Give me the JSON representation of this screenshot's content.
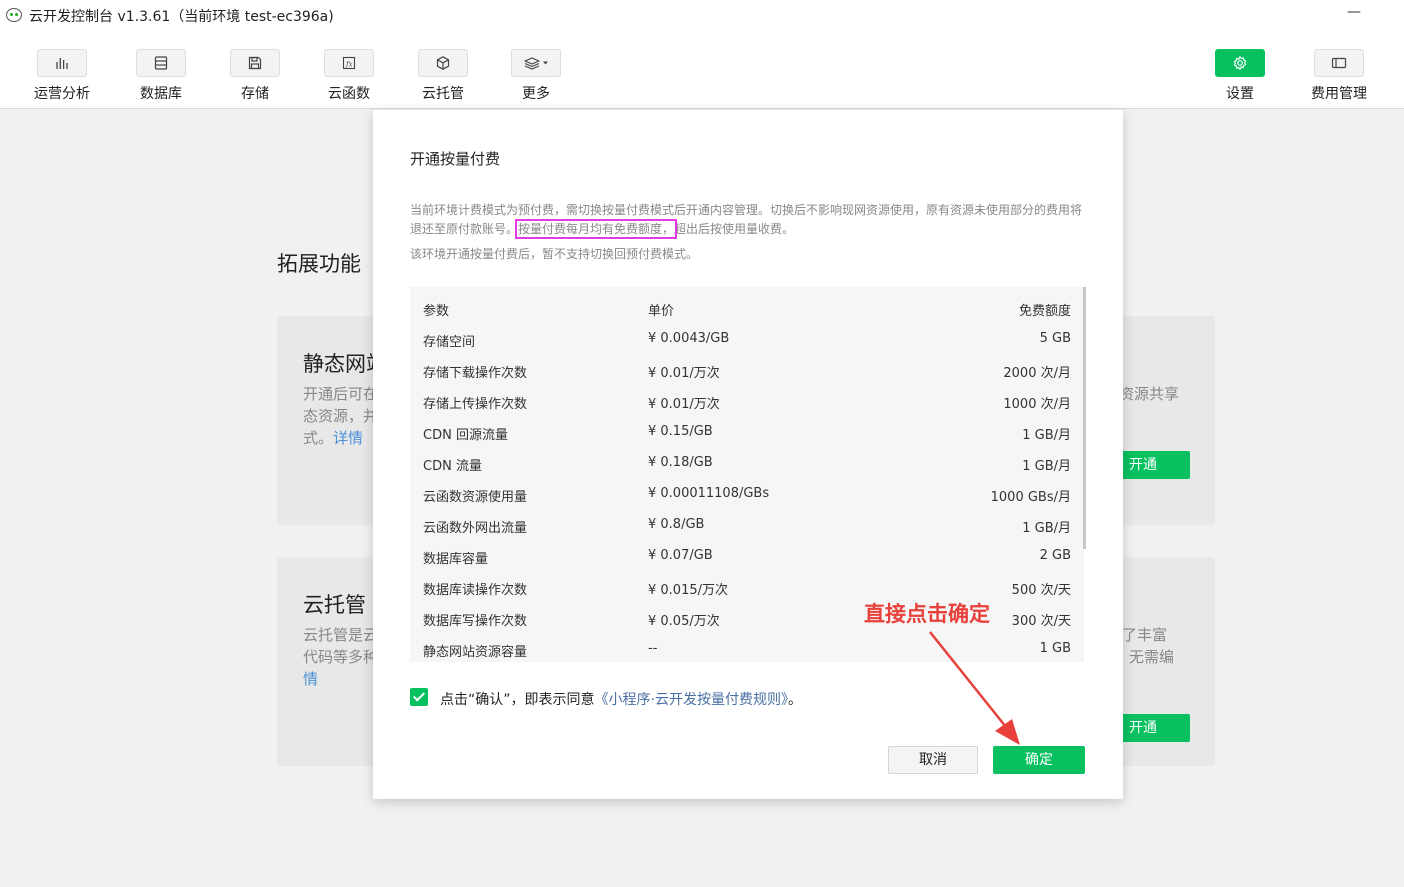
{
  "window": {
    "title": "云开发控制台 v1.3.61（当前环境 test-ec396a)",
    "minimize": "—"
  },
  "toolbar": {
    "left": [
      {
        "label": "运营分析",
        "icon": "bar-chart-icon"
      },
      {
        "label": "数据库",
        "icon": "database-icon"
      },
      {
        "label": "存储",
        "icon": "save-disk-icon"
      },
      {
        "label": "云函数",
        "icon": "function-icon"
      },
      {
        "label": "云托管",
        "icon": "cube-icon"
      },
      {
        "label": "更多",
        "icon": "layers-dropdown-icon"
      }
    ],
    "right": [
      {
        "label": "设置",
        "icon": "gear-icon"
      },
      {
        "label": "费用管理",
        "icon": "wallet-icon"
      }
    ]
  },
  "page": {
    "section_title": "拓展功能",
    "card1": {
      "title": "静态网站",
      "desc_line1": "开通后可在",
      "desc_line2": "态资源，并",
      "desc_line3": "式。",
      "detail": "详情",
      "right_desc": "资源共享",
      "open": "开通"
    },
    "card2": {
      "title": "云托管",
      "desc_line1": "云托管是云",
      "desc_line2": "代码等多种",
      "detail": "情",
      "right_desc1": "了丰富",
      "right_desc2": "无需编",
      "open": "开通"
    }
  },
  "modal": {
    "title": "开通按量付费",
    "notice_part1": "当前环境计费模式为预付费，需切换按量付费模式后开通内容管理。切换后不影响现网资源使用，原有资源未使用部分的费用将退还至原付款账号。",
    "notice_highlight": "按量付费每月均有免费额度，",
    "notice_part2": "超出后按使用量收费。",
    "notice2": "该环境开通按量付费后，暂不支持切换回预付费模式。",
    "table": {
      "headers": [
        "参数",
        "单价",
        "免费额度"
      ],
      "rows": [
        [
          "存储空间",
          "¥ 0.0043/GB",
          "5 GB"
        ],
        [
          "存储下载操作次数",
          "¥ 0.01/万次",
          "2000 次/月"
        ],
        [
          "存储上传操作次数",
          "¥ 0.01/万次",
          "1000 次/月"
        ],
        [
          "CDN 回源流量",
          "¥ 0.15/GB",
          "1 GB/月"
        ],
        [
          "CDN 流量",
          "¥ 0.18/GB",
          "1 GB/月"
        ],
        [
          "云函数资源使用量",
          "¥ 0.00011108/GBs",
          "1000 GBs/月"
        ],
        [
          "云函数外网出流量",
          "¥ 0.8/GB",
          "1 GB/月"
        ],
        [
          "数据库容量",
          "¥ 0.07/GB",
          "2 GB"
        ],
        [
          "数据库读操作次数",
          "¥ 0.015/万次",
          "500 次/天"
        ],
        [
          "数据库写操作次数",
          "¥ 0.05/万次",
          "300 次/天"
        ],
        [
          "静态网站资源容量",
          "--",
          "1 GB"
        ]
      ]
    },
    "agree_prefix": "点击“确认”，即表示同意",
    "agree_link": "《小程序·云开发按量付费规则》",
    "agree_suffix": "。",
    "agree_checked": true,
    "cancel": "取消",
    "confirm": "确定"
  },
  "annotation": {
    "text": "直接点击确定",
    "color": "#e8403b"
  },
  "colors": {
    "accent_green": "#07c160",
    "highlight_box": "#e23ae6",
    "link_blue": "#4a8fd6"
  }
}
